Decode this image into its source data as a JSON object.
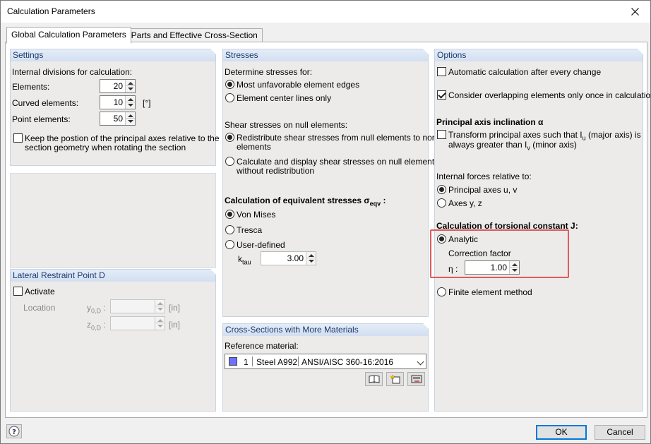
{
  "window": {
    "title": "Calculation Parameters"
  },
  "tabs": [
    {
      "label": "Global Calculation Parameters",
      "active": true
    },
    {
      "label": "c/t-Parts and Effective Cross-Section",
      "active": false
    }
  ],
  "settings": {
    "header": "Settings",
    "internal_divisions": "Internal divisions for calculation:",
    "elements_label": "Elements:",
    "elements_value": "20",
    "curved_label": "Curved elements:",
    "curved_value": "10",
    "curved_unit": "[°]",
    "point_label": "Point elements:",
    "point_value": "50",
    "keep_position_line1": "Keep the postion of the principal axes relative to the",
    "keep_position_line2": "section geometry when rotating the section",
    "keep_position_checked": false
  },
  "lateral": {
    "header": "Lateral Restraint Point D",
    "activate_label": "Activate",
    "location_label": "Location",
    "y_label": "y",
    "y_sub": "0,D",
    "z_label": "z",
    "z_sub": "0,D",
    "y_unit": "[in]",
    "z_unit": "[in]"
  },
  "stresses": {
    "header": "Stresses",
    "determine_label": "Determine stresses for:",
    "most_unfavorable": "Most unfavorable element edges",
    "center_lines": "Element center lines only",
    "shear_label": "Shear stresses on null elements:",
    "redistribute_line1": "Redistribute shear stresses from null elements to normal",
    "redistribute_line2": "elements",
    "calc_display_line1": "Calculate and display shear stresses on null elements",
    "calc_display_line2": "without redistribution",
    "equiv_label": "Calculation of equivalent stresses σ",
    "equiv_sub": "eqv",
    "equiv_colon": " :",
    "von_mises": "Von Mises",
    "tresca": "Tresca",
    "user_defined": "User-defined",
    "ktau_label": "k",
    "ktau_sub": "tau",
    "ktau_value": "3.00"
  },
  "cross_sections": {
    "header": "Cross-Sections with More Materials",
    "reference_label": "Reference material:",
    "material_no": "1",
    "material_name": "Steel A992",
    "material_standard": "ANSI/AISC 360-16:2016",
    "swatch_color": "#7070ff"
  },
  "options": {
    "header": "Options",
    "auto_calc": "Automatic calculation after every change",
    "auto_calc_checked": false,
    "overlap": "Consider overlapping elements only once in calculation",
    "overlap_checked": true,
    "principal_axis_label": "Principal axis inclination α",
    "transform_line1": "Transform principal axes such that I",
    "transform_sub_u": "u",
    "transform_line1b": " (major axis) is",
    "transform_line2": "always greater than I",
    "transform_sub_v": "v",
    "transform_line2b": " (minor axis)",
    "transform_checked": false,
    "internal_forces_label": "Internal forces relative to:",
    "principal_axes": "Principal axes u, v",
    "axes_yz": "Axes y, z",
    "torsional_label": "Calculation of torsional constant J:",
    "analytic": "Analytic",
    "correction_factor": "Correction factor",
    "eta_label": "η :",
    "eta_value": "1.00",
    "finite_element": "Finite element method"
  },
  "footer": {
    "ok": "OK",
    "cancel": "Cancel"
  },
  "colors": {
    "accent": "#0078d7",
    "highlight": "#e05a5a",
    "group_header_text": "#1a3a6e"
  }
}
